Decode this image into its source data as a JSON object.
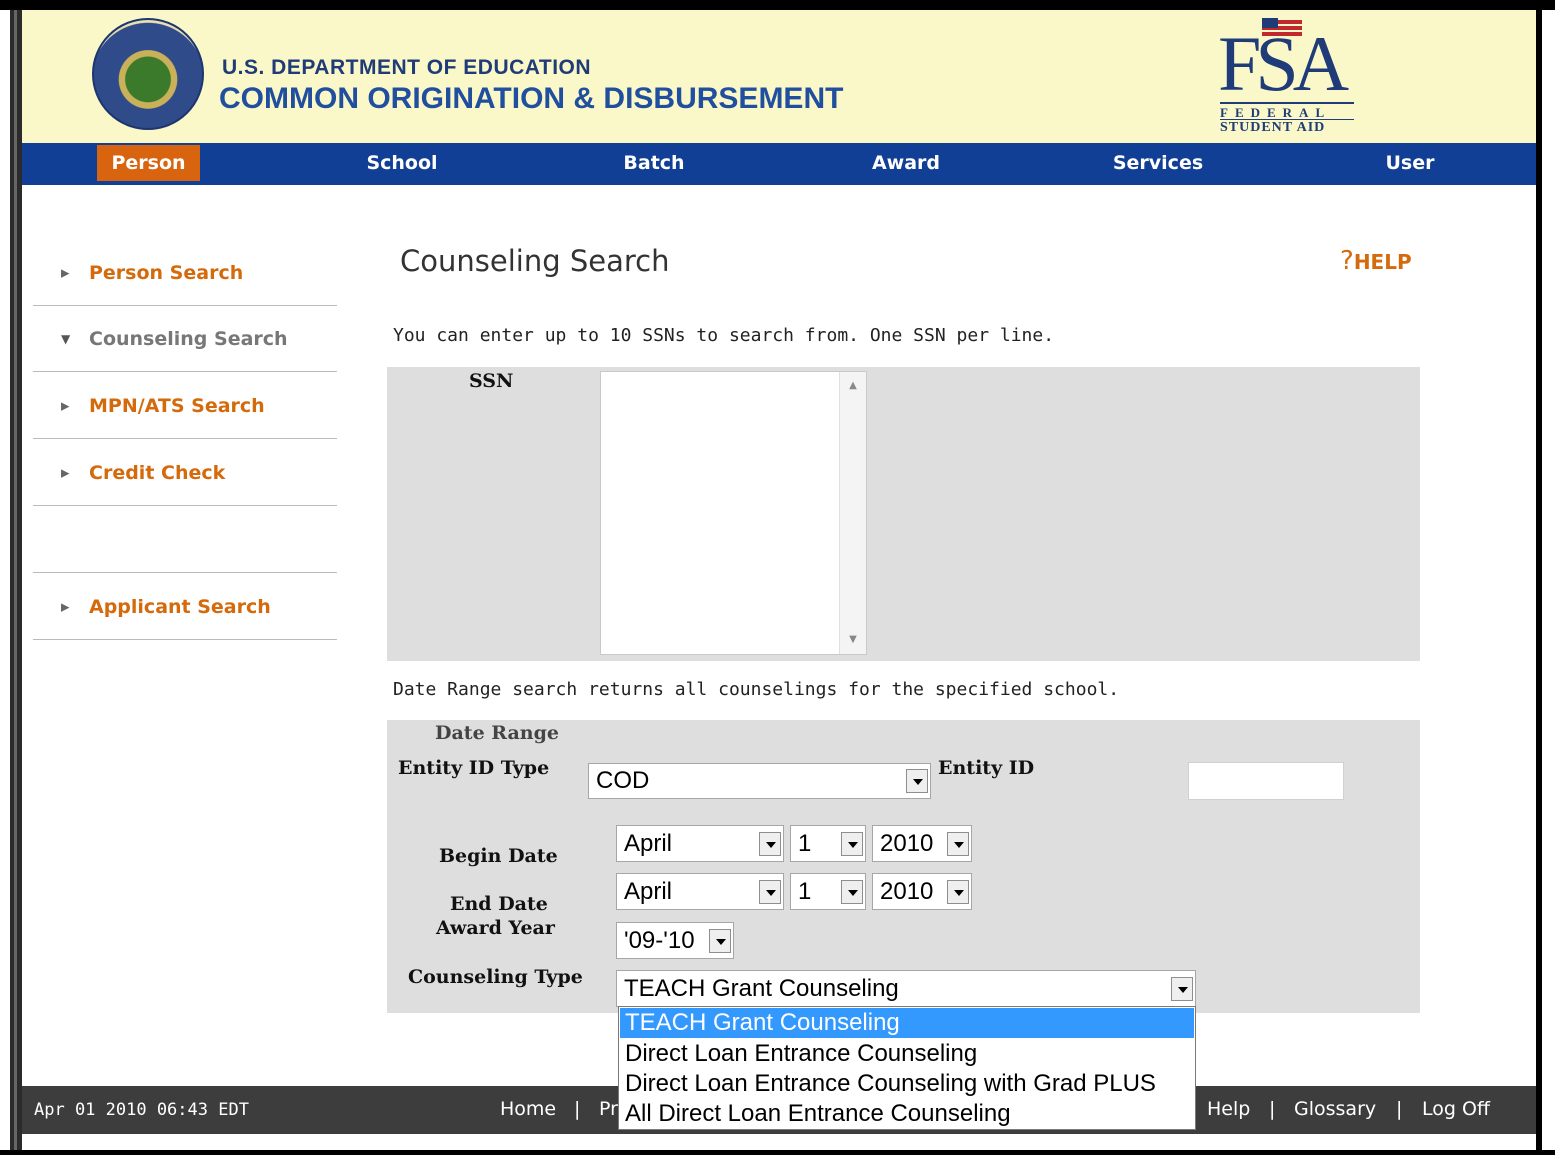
{
  "header": {
    "dept": "U.S. DEPARTMENT OF EDUCATION",
    "system": "COMMON ORIGINATION & DISBURSEMENT",
    "fsa_logo": {
      "big": "FSA",
      "line1": "FEDERAL",
      "line2": "STUDENT AID"
    }
  },
  "nav": {
    "items": [
      "Person",
      "School",
      "Batch",
      "Award",
      "Services",
      "User"
    ],
    "active": "Person"
  },
  "sidebar": {
    "items": [
      {
        "label": "Person Search"
      },
      {
        "label": "Counseling Search"
      },
      {
        "label": "MPN/ATS Search"
      },
      {
        "label": "Credit Check"
      },
      {
        "label": ""
      },
      {
        "label": "Applicant Search"
      }
    ],
    "current": "Counseling Search"
  },
  "page": {
    "title": "Counseling Search",
    "help": "HELP",
    "ssn_instruction": "You can enter up to 10 SSNs to search from. One SSN per line.",
    "ssn_label": "SSN",
    "ssn_value": "",
    "date_instruction": "Date Range search returns all counselings for the specified school.",
    "date_range_heading": "Date Range",
    "entity_id_type_label": "Entity ID Type",
    "entity_id_type_value": "COD",
    "entity_id_label": "Entity ID",
    "entity_id_value": "",
    "begin_date_label": "Begin Date",
    "begin_date": {
      "month": "April",
      "day": "1",
      "year": "2010"
    },
    "end_date_label": "End Date",
    "end_date": {
      "month": "April",
      "day": "1",
      "year": "2010"
    },
    "award_year_label": "Award Year",
    "award_year_value": "'09-'10",
    "counseling_type_label": "Counseling Type",
    "counseling_type_value": "TEACH Grant Counseling",
    "counseling_type_options": [
      "TEACH Grant Counseling",
      "Direct Loan Entrance Counseling",
      "Direct Loan Entrance Counseling with Grad PLUS",
      "All Direct Loan Entrance Counseling"
    ]
  },
  "footer": {
    "timestamp": "Apr 01 2010 06:43 EDT",
    "left_links": [
      "Home",
      "Pr"
    ],
    "right_links": [
      "Help",
      "Glossary",
      "Log Off"
    ]
  },
  "colors": {
    "header_bg": "#faf8c8",
    "nav_bg": "#123f96",
    "nav_active": "#d9640f",
    "link_orange": "#d46a0c",
    "panel_gray": "#dedede",
    "footer_bg": "#3d3d3d",
    "highlight": "#3399ff"
  }
}
